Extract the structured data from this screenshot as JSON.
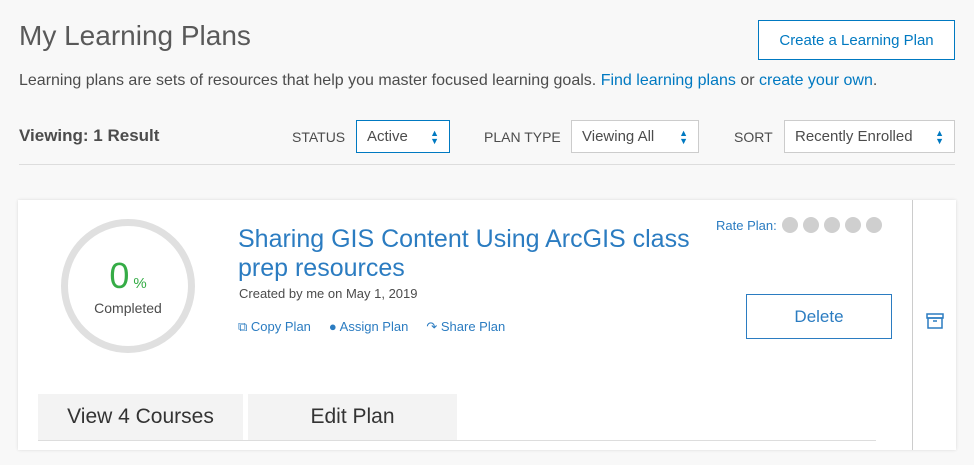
{
  "page": {
    "title": "My Learning Plans",
    "create_button": "Create a Learning Plan",
    "description": "Learning plans are sets of resources that help you master focused learning goals.",
    "desc_link1": "Find learning plans",
    "desc_or": " or ",
    "desc_link2": "create your own",
    "desc_end": "."
  },
  "filters": {
    "viewing": "Viewing: 1 Result",
    "status_label": "STATUS",
    "status_value": "Active",
    "plan_type_label": "PLAN TYPE",
    "plan_type_value": "Viewing All",
    "sort_label": "SORT",
    "sort_value": "Recently Enrolled"
  },
  "plan": {
    "progress_value": "0",
    "progress_unit": "%",
    "progress_label": "Completed",
    "title": "Sharing GIS Content Using ArcGIS class prep resources",
    "created": "Created by me on May 1, 2019",
    "copy": "Copy Plan",
    "assign": "Assign Plan",
    "share": "Share Plan",
    "rate_label": "Rate Plan:",
    "rating": 0,
    "rating_max": 5,
    "delete": "Delete",
    "view_courses": "View 4 Courses",
    "edit": "Edit Plan"
  }
}
